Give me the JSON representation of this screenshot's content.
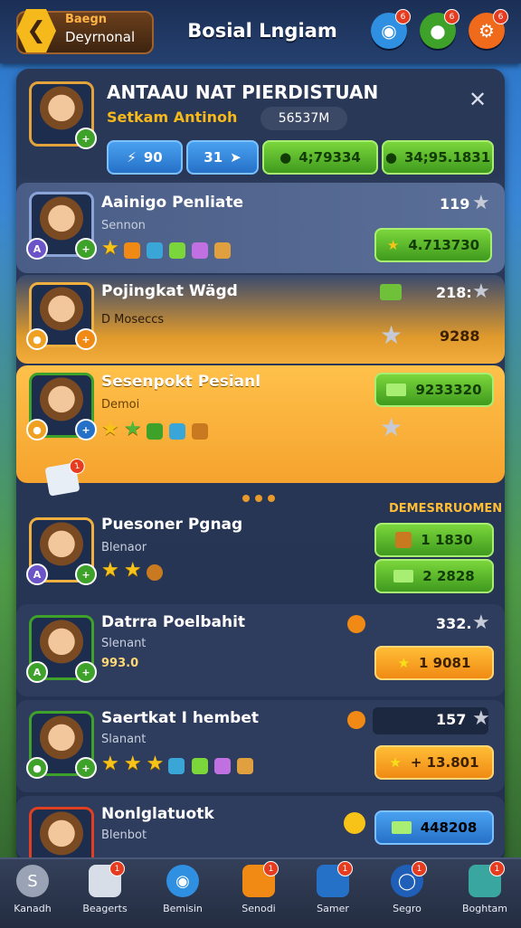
{
  "header": {
    "back_top": "Baegn",
    "back_sub": "Deyrnonal",
    "title": "Bosial Lngiam",
    "buttons": [
      {
        "icon": "globe-icon",
        "badge": "6",
        "color": "#2f8fe0"
      },
      {
        "icon": "chat-icon",
        "badge": "6",
        "color": "#3ea12a"
      },
      {
        "icon": "settings-icon",
        "badge": "6",
        "color": "#f06a1c"
      }
    ]
  },
  "profile": {
    "name": "ANTAAU NAT PIERDISTUAN",
    "subtitle": "Setkam Antinoh",
    "value": "56537M",
    "stats": [
      "90",
      "31",
      "4;79334",
      "34;95.1831"
    ]
  },
  "rows": [
    {
      "name": "Aainigo Penliate",
      "sub": "Sennon",
      "rank": "119",
      "value": "4.713730",
      "style": "green",
      "stars": 1
    },
    {
      "name": "Pojingkat Wägd",
      "sub": "D Moseccs",
      "rank": "218:",
      "value": "9288",
      "style": "plain",
      "stars": 0
    },
    {
      "name": "Sesenpokt Pesianl",
      "sub": "Demoi",
      "rank": "",
      "value": "9233320",
      "style": "green",
      "stars": 2
    },
    {
      "name": "Puesoner Pgnag",
      "sub": "Blenaor",
      "rank": "",
      "value": "1 1830",
      "value2": "2 2828",
      "style": "green",
      "stars": 2
    },
    {
      "name": "Datrra Poelbahit",
      "sub": "Slenant",
      "rank": "332.",
      "value": "1 9081",
      "style": "orange",
      "stars": 0,
      "extra": "993.0"
    },
    {
      "name": "Saertkat I hembet",
      "sub": "Slanant",
      "rank": "157",
      "value": "+ 13.801",
      "style": "orange",
      "stars": 3
    },
    {
      "name": "Nonlglatuotk",
      "sub": "Blenbot",
      "rank": "",
      "value": "448208",
      "style": "blue",
      "stars": 0
    }
  ],
  "section_label": "DEMESRRUOMEN",
  "nav": [
    {
      "label": "Kanadh",
      "icon": "coin-icon"
    },
    {
      "label": "Beagerts",
      "icon": "chest-icon"
    },
    {
      "label": "Bemisin",
      "icon": "globe-icon"
    },
    {
      "label": "Senodi",
      "icon": "shop-icon"
    },
    {
      "label": "Samer",
      "icon": "cube-icon"
    },
    {
      "label": "Segro",
      "icon": "ring-icon"
    },
    {
      "label": "Boghtam",
      "icon": "map-icon"
    }
  ]
}
